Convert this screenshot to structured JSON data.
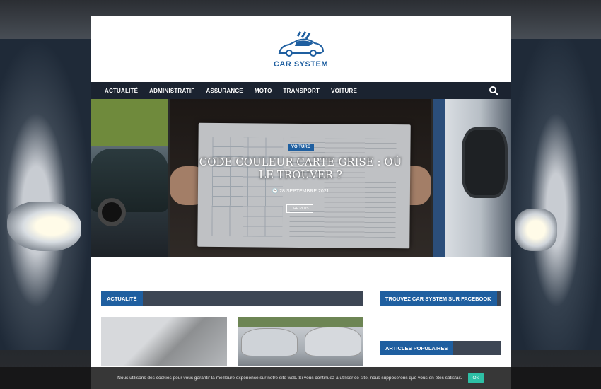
{
  "site": {
    "name": "CAR SYSTEM"
  },
  "nav": {
    "items": [
      "ACTUALITÉ",
      "ADMINISTRATIF",
      "ASSURANCE",
      "MOTO",
      "TRANSPORT",
      "VOITURE"
    ],
    "search_icon": "search-icon"
  },
  "slider": {
    "category": "VOITURE",
    "title": "CODE COULEUR CARTE GRISE : OÙ LE TROUVER ?",
    "date": "28 SEPTEMBRE 2021",
    "read_more": "LIRE PLUS"
  },
  "sections": {
    "actualite": "ACTUALITÉ",
    "facebook": "TROUVEZ CAR SYSTEM SUR FACEBOOK",
    "populaires": "ARTICLES POPULAIRES"
  },
  "cookie": {
    "message": "Nous utilisons des cookies pour vous garantir la meilleure expérience sur notre site web. Si vous continuez à utiliser ce site, nous supposerons que vous en êtes satisfait.",
    "ok": "Ok"
  },
  "colors": {
    "accent": "#1f5fa0",
    "nav_bg": "#1b2330",
    "ok_button": "#2ebfa5"
  }
}
